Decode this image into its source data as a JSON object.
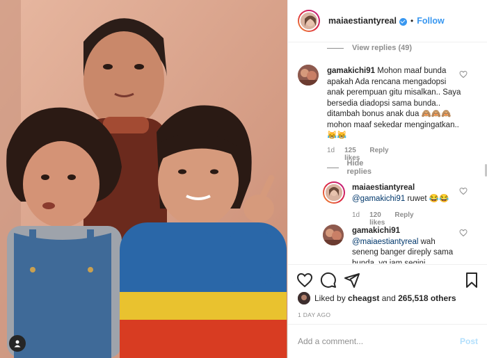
{
  "post": {
    "username": "maiaestiantyreal",
    "follow_label": "Follow",
    "separator": "•"
  },
  "comments": {
    "view_replies_label": "View replies (49)",
    "top_comment": {
      "user": "gamakichi91",
      "text": "Mohon maaf bunda apakah Ada rencana mengadopsi anak perempuan gitu misalkan.. Saya bersedia diadopsi sama bunda.. ditambah bonus anak dua 🙈🙈🙈 mohon maaf sekedar mengingatkan.. 😹😹",
      "time": "1d",
      "likes": "125 likes",
      "reply_label": "Reply",
      "hide_replies_label": "Hide replies"
    },
    "reply_1": {
      "user": "maiaestiantyreal",
      "mention": "@gamakichi91",
      "text": "ruwet 😂😂",
      "time": "1d",
      "likes": "120 likes",
      "reply_label": "Reply"
    },
    "reply_2": {
      "user": "gamakichi91",
      "mention": "@maiaestiantyreal",
      "text": "wah seneng banger direply sama bunda..yg jam segini"
    }
  },
  "actions": {
    "icons": [
      "heart-icon",
      "comment-icon",
      "share-icon",
      "bookmark-icon"
    ]
  },
  "likes": {
    "prefix": "Liked by",
    "user": "cheagst",
    "middle": "and",
    "count": "265,518 others"
  },
  "date": "1 DAY AGO",
  "add_comment": {
    "placeholder": "Add a comment...",
    "post_label": "Post"
  },
  "colors": {
    "link_blue": "#3897f0",
    "muted_gray": "#8e8e8e",
    "post_disabled": "#b2dffc"
  }
}
